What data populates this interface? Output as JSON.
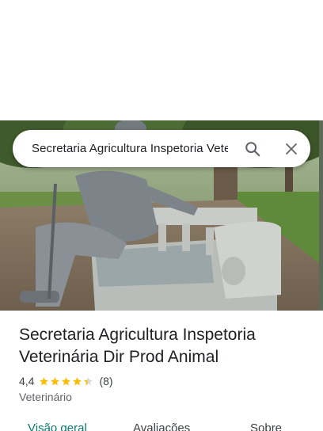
{
  "search": {
    "query": "Secretaria Agricultura Inspetoria Veterinária Dir Prod Animal"
  },
  "place": {
    "name": "Secretaria Agricultura Inspetoria Veterinária Dir Prod Animal",
    "rating": "4,4",
    "rating_stars": 4.4,
    "review_count": "(8)",
    "category": "Veterinário"
  },
  "tabs": [
    {
      "label": "Visão geral",
      "active": true
    },
    {
      "label": "Avaliações",
      "active": false
    },
    {
      "label": "Sobre",
      "active": false
    }
  ],
  "colors": {
    "accent": "#0b7b6f",
    "star": "#fbbc04",
    "text_primary": "#202124",
    "text_secondary": "#5f6368"
  },
  "icons": {
    "search": "search-icon",
    "close": "close-icon",
    "star": "star-icon"
  }
}
